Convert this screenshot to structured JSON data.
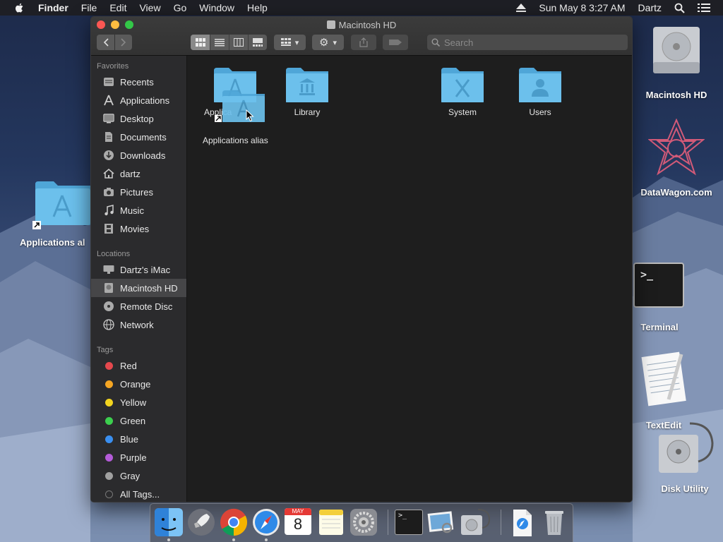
{
  "menubar": {
    "app": "Finder",
    "items": [
      "File",
      "Edit",
      "View",
      "Go",
      "Window",
      "Help"
    ],
    "clock": "Sun May 8  3:27 AM",
    "user": "Dartz"
  },
  "window": {
    "title": "Macintosh HD",
    "search_placeholder": "Search"
  },
  "sidebar": {
    "favorites_header": "Favorites",
    "favorites": [
      "Recents",
      "Applications",
      "Desktop",
      "Documents",
      "Downloads",
      "dartz",
      "Pictures",
      "Music",
      "Movies"
    ],
    "locations_header": "Locations",
    "locations": [
      "Dartz's iMac",
      "Macintosh HD",
      "Remote Disc",
      "Network"
    ],
    "selected": "Macintosh HD",
    "tags_header": "Tags",
    "tags": [
      {
        "label": "Red",
        "color": "#e5484d"
      },
      {
        "label": "Orange",
        "color": "#f5a623"
      },
      {
        "label": "Yellow",
        "color": "#f2d41f"
      },
      {
        "label": "Green",
        "color": "#3ccf4e"
      },
      {
        "label": "Blue",
        "color": "#3a8ff0"
      },
      {
        "label": "Purple",
        "color": "#b45bd8"
      },
      {
        "label": "Gray",
        "color": "#a0a0a0"
      }
    ],
    "all_tags": "All Tags..."
  },
  "content": {
    "items": [
      "Applica",
      "Library",
      "System",
      "Users"
    ],
    "drag_label": "Applications alias"
  },
  "desktop": {
    "items": [
      "Macintosh HD",
      "DataWagon.com",
      "Terminal",
      "TextEdit",
      "Disk Utility",
      "Applications al"
    ]
  },
  "dock": {
    "calendar_month": "MAY",
    "calendar_day": "8"
  },
  "colors": {
    "folder": "#5fb6e6",
    "accent": "#464648"
  }
}
